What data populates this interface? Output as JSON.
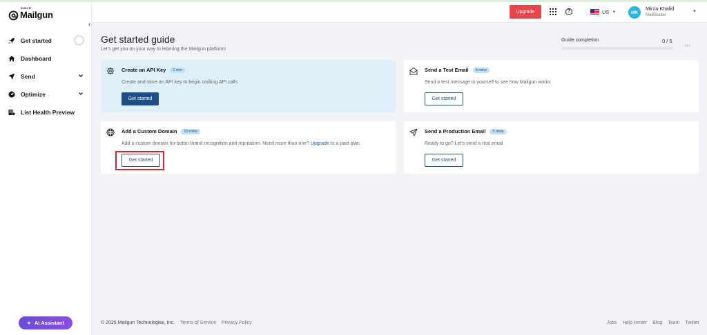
{
  "brand": {
    "small": "SINCH",
    "name": "Mailgun"
  },
  "sidebar": {
    "collapse_icon": "chevron-left-icon",
    "items": [
      {
        "label": "Get started",
        "icon": "rocket-icon"
      },
      {
        "label": "Dashboard",
        "icon": "home-icon"
      },
      {
        "label": "Send",
        "icon": "send-icon"
      },
      {
        "label": "Optimize",
        "icon": "gauge-icon"
      },
      {
        "label": "List Health Preview",
        "icon": "list-health-icon"
      }
    ],
    "ai_assistant_label": "AI Assistant"
  },
  "header": {
    "upgrade_label": "Upgrade",
    "region": "US",
    "user": {
      "initials": "MK",
      "name": "Mirza Khalid",
      "org": "MailBluster"
    }
  },
  "guide": {
    "title": "Get started guide",
    "subtitle": "Let's get you on your way to learning the Mailgun platform!",
    "completion_label": "Guide completion",
    "completion_count": "0 / 5",
    "completion_fraction": 0,
    "more_label": "..."
  },
  "cards": [
    {
      "title": "Create an API Key",
      "badge": "1 min",
      "desc": "Create and store an API key to begin crafting API calls",
      "button": "Get started",
      "icon": "gear-icon"
    },
    {
      "title": "Send a Test Email",
      "badge": "5 mins",
      "desc": "Send a test message to yourself to see how Mailgun works",
      "button": "Get started",
      "icon": "mail-open-icon"
    },
    {
      "title": "Add a Custom Domain",
      "badge": "10 mins",
      "desc_pre": "Add a custom domain for better brand recognition and reputation. Need more than one? ",
      "desc_link": "Upgrade",
      "desc_post": " to a paid plan.",
      "button": "Get started",
      "icon": "globe-icon"
    },
    {
      "title": "Send a Production Email",
      "badge": "5 mins",
      "desc": "Ready to go? Let's send a real email.",
      "button": "Get started",
      "icon": "paper-plane-icon"
    }
  ],
  "footer": {
    "copyright": "© 2025 Mailgun Technologies, Inc.",
    "terms": "Terms of Service",
    "privacy": "Privacy Policy",
    "links": [
      "Jobs",
      "Help center",
      "Blog",
      "Team",
      "Twitter"
    ]
  },
  "colors": {
    "accent": "#1d4f86",
    "upgrade": "#e6464b",
    "highlight": "#d9232d",
    "active_card": "#dff0fb"
  }
}
